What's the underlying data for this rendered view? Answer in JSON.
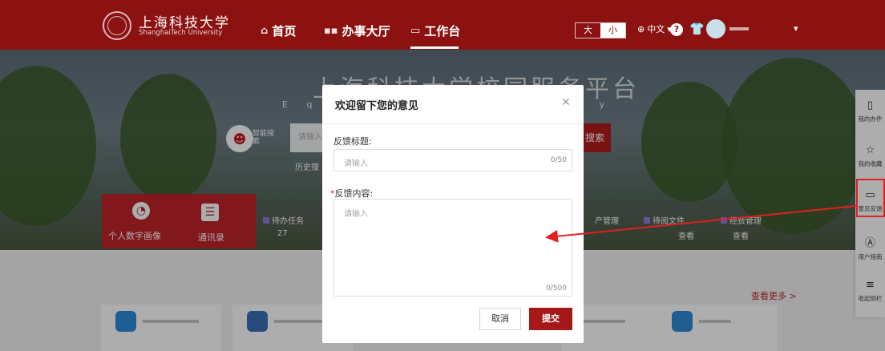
{
  "header": {
    "uni_name_cn": "上海科技大学",
    "uni_name_en": "ShanghaiTech University",
    "nav": [
      {
        "label": "首页",
        "icon": "home-icon"
      },
      {
        "label": "办事大厅",
        "icon": "grid-icon"
      },
      {
        "label": "工作台",
        "icon": "desk-icon"
      }
    ],
    "font_size_toggle": {
      "large": "大",
      "small": "小",
      "selected": "小"
    },
    "language": "中文",
    "colors": {
      "brand": "#8c1212",
      "accent": "#a61818"
    }
  },
  "hero": {
    "title": "上海科技大学校园服务平台",
    "subtitle_fragments": [
      "E",
      "q",
      "a",
      "i",
      "t",
      "y"
    ],
    "ai_label": "智能搜索",
    "search_placeholder": "请输入",
    "search_button": "搜索",
    "history_label": "历史搜",
    "cards": [
      {
        "label": "个人数字画像",
        "icon": "pie-chart-icon"
      },
      {
        "label": "通讯录",
        "icon": "contacts-icon"
      }
    ],
    "stats": [
      {
        "label": "待办任务",
        "value": "27"
      },
      {
        "label": "产管理",
        "value": ""
      },
      {
        "label": "待阅文件",
        "value": "查看"
      },
      {
        "label": "经费管理",
        "value": "查看"
      }
    ]
  },
  "content": {
    "more_link": "查看更多 >"
  },
  "right_panel": {
    "items": [
      {
        "label": "我的办件",
        "icon": "document-icon"
      },
      {
        "label": "我的收藏",
        "icon": "star-icon"
      },
      {
        "label": "意见反馈",
        "icon": "feedback-icon"
      },
      {
        "label": "用户指南",
        "icon": "guide-icon"
      },
      {
        "label": "收起侧栏",
        "icon": "menu-icon"
      }
    ]
  },
  "modal": {
    "title": "欢迎留下您的意见",
    "title_label": "反馈标题:",
    "title_placeholder": "请输入",
    "title_counter": "0/50",
    "content_required_mark": "*",
    "content_label": "反馈内容:",
    "content_placeholder": "请输入",
    "content_counter": "0/500",
    "cancel_label": "取消",
    "submit_label": "提交"
  }
}
